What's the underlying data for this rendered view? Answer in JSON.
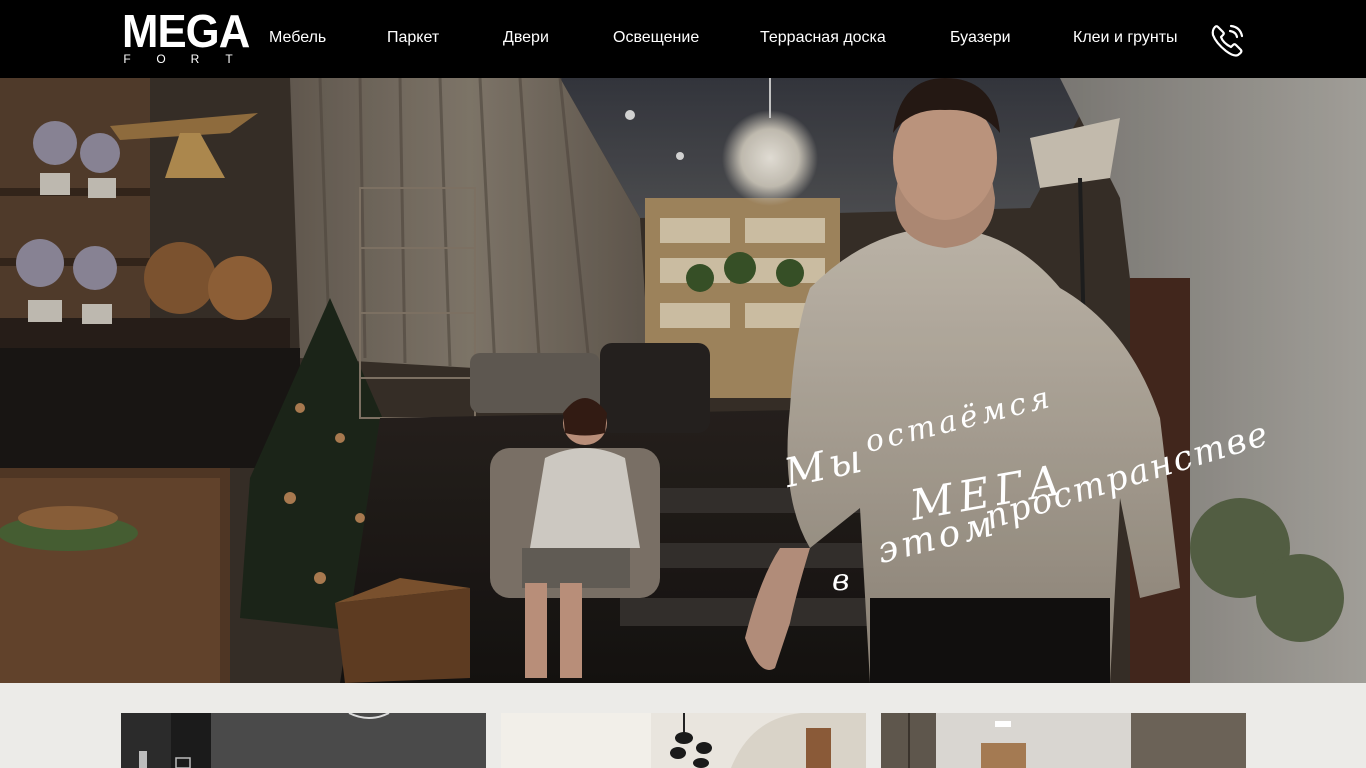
{
  "brand": {
    "logo_main": "MEGA",
    "logo_sub": [
      "F",
      "O",
      "R",
      "T"
    ]
  },
  "nav": {
    "items": [
      {
        "label": "Мебель",
        "name": "nav-item-furniture"
      },
      {
        "label": "Паркет",
        "name": "nav-item-parquet"
      },
      {
        "label": "Двери",
        "name": "nav-item-doors"
      },
      {
        "label": "Освещение",
        "name": "nav-item-lighting"
      },
      {
        "label": "Террасная доска",
        "name": "nav-item-terrace-board"
      },
      {
        "label": "Буазери",
        "name": "nav-item-boiserie"
      },
      {
        "label": "Клеи и грунты",
        "name": "nav-item-glues-primers"
      }
    ],
    "phone_icon": "phone-icon"
  },
  "hero": {
    "slogan": {
      "line1a": "Мы",
      "line1b": "остаёмся",
      "line2": "МЕГА",
      "line3a": "в",
      "line3b": "этом",
      "line3c": "пространстве"
    }
  },
  "colors": {
    "header_bg": "#000000",
    "band_bg": "#ecebe8",
    "text": "#ffffff"
  }
}
